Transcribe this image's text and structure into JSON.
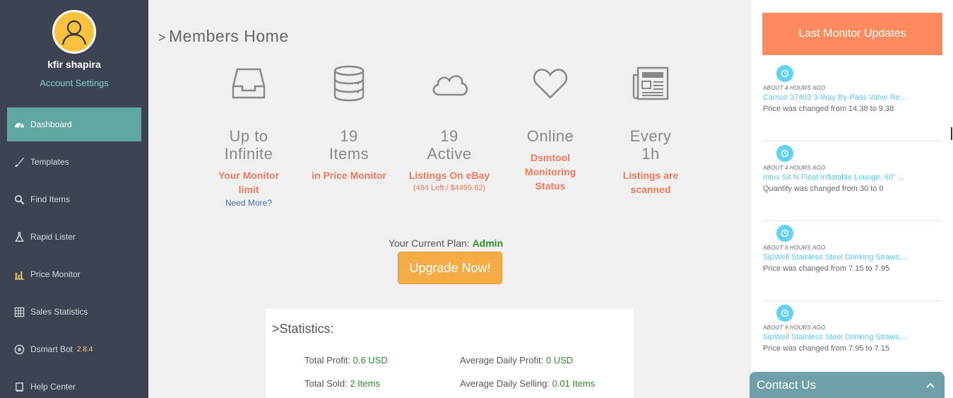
{
  "user": {
    "name": "kfir shapira",
    "account_settings": "Account Settings"
  },
  "nav": [
    {
      "label": "Dashboard",
      "icon": "dashboard-icon"
    },
    {
      "label": "Templates",
      "icon": "brush-icon"
    },
    {
      "label": "Find Items",
      "icon": "search-icon"
    },
    {
      "label": "Rapid Lister",
      "icon": "flask-icon"
    },
    {
      "label": "Price Monitor",
      "icon": "bar-chart-icon"
    },
    {
      "label": "Sales Statistics",
      "icon": "table-icon"
    },
    {
      "label": "Dsmart Bot",
      "icon": "chrome-icon",
      "version": "2.8.4"
    },
    {
      "label": "Help Center",
      "icon": "book-icon"
    }
  ],
  "page": {
    "title": "Members Home"
  },
  "stats": [
    {
      "big1": "Up to",
      "big2": "Infinite",
      "sub1": "Your Monitor",
      "sub2": "limit",
      "extra": "Need More?",
      "icon": "inbox-icon"
    },
    {
      "big1": "19",
      "big2": "Items",
      "sub1": "in Price Monitor",
      "icon": "database-icon"
    },
    {
      "big1": "19",
      "big2": "Active",
      "sub1": "Listings On eBay",
      "extra": "(484 Left / $4499.62)",
      "icon": "cloud-icon"
    },
    {
      "big1": "Online",
      "sub1": "Dsmtool",
      "sub2": "Monitoring",
      "sub3": "Status",
      "icon": "heart-icon"
    },
    {
      "big1": "Every",
      "big2": "1h",
      "sub1": "Listings are",
      "sub2": "scanned",
      "icon": "newspaper-icon"
    }
  ],
  "plan": {
    "label": "Your Current Plan: ",
    "value": "Admin",
    "upgrade": "Upgrade Now!"
  },
  "statistics": {
    "title": "Statistics:",
    "total_profit_label": "Total Profit: ",
    "total_profit_value": "0.6 USD",
    "avg_daily_profit_label": "Average Daily Profit: ",
    "avg_daily_profit_value": "0 USD",
    "total_sold_label": "Total Sold: ",
    "total_sold_value": "2 Items",
    "avg_daily_selling_label": "Average Daily Selling: ",
    "avg_daily_selling_value": "0.01 Items"
  },
  "updates": {
    "header": "Last Monitor Updates",
    "items": [
      {
        "time": "ABOUT 4 HOURS AGO",
        "title": "Camco 37463 3-Way By-Pass Valve Repla...",
        "msg": "Price was changed from 14.38 to 9.38"
      },
      {
        "time": "ABOUT 4 HOURS AGO",
        "title": "Intex Sit N Float Inflatable Lounge, 60\" ...",
        "msg": "Quantity was changed from 30 to 0"
      },
      {
        "time": "ABOUT 6 HOURS AGO",
        "title": "SipWell Stainless Steel Drinking Straws,...",
        "msg": "Price was changed from 7.15 to 7.95"
      },
      {
        "time": "ABOUT 9 HOURS AGO",
        "title": "SipWell Stainless Steel Drinking Straws,...",
        "msg": "Price was changed from 7.95 to 7.15"
      }
    ]
  },
  "contact": {
    "label": "Contact Us"
  }
}
